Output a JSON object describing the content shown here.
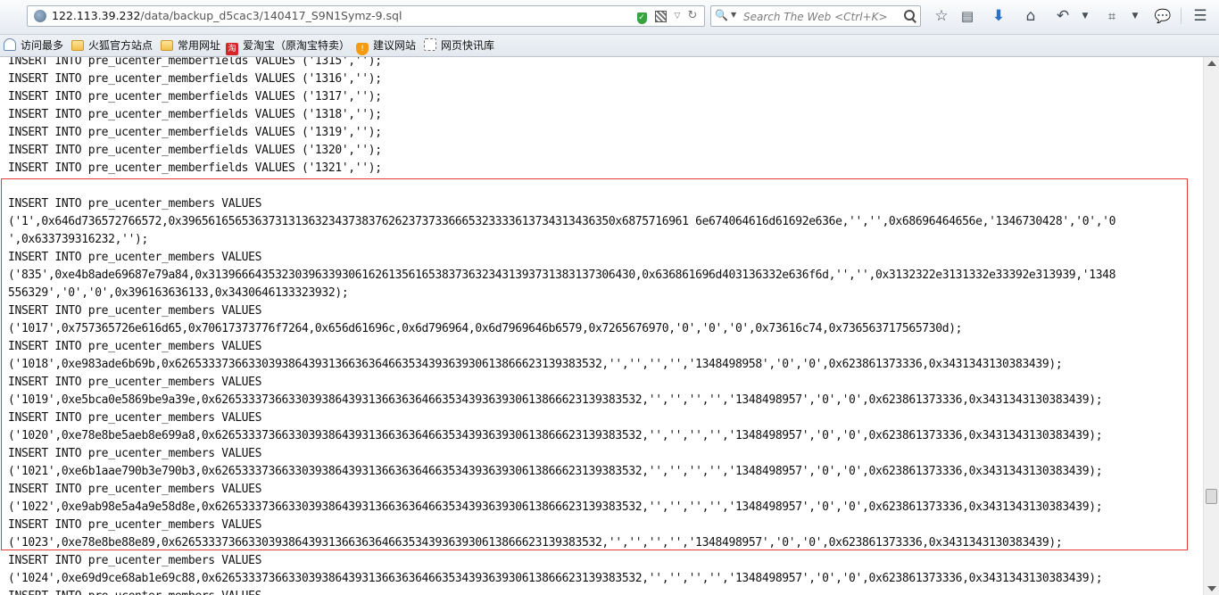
{
  "browser": {
    "url_host": "122.113.39.232",
    "url_path": "/data/backup_d5cac3/140417_S9N1Symz-9.sql",
    "search_placeholder": "Search The Web <Ctrl+K>",
    "icons": {
      "site": "globe-icon",
      "shield": "shield-icon",
      "qr": "qr-code-icon",
      "bookmark": "star-icon",
      "library": "reading-list-icon",
      "download": "download-arrow-icon",
      "home": "home-icon",
      "back": "undo-arrow-icon",
      "screenshot": "crop-icon",
      "chat": "chat-bubble-icon",
      "menu": "hamburger-menu-icon"
    }
  },
  "bookmarks": [
    {
      "label": "访问最多",
      "icon": "clip-icon"
    },
    {
      "label": "火狐官方站点",
      "icon": "folder-icon"
    },
    {
      "label": "常用网址",
      "icon": "folder-icon"
    },
    {
      "label": "爱淘宝（原淘宝特卖）",
      "icon": "taobao-icon"
    },
    {
      "label": "建议网站",
      "icon": "suggest-icon"
    },
    {
      "label": "网页快讯库",
      "icon": "web-slice-icon"
    }
  ],
  "highlight_color": "#e23b3b",
  "sql_lines": [
    "INSERT INTO pre_ucenter_memberfields VALUES ('1315','');",
    "INSERT INTO pre_ucenter_memberfields VALUES ('1316','');",
    "INSERT INTO pre_ucenter_memberfields VALUES ('1317','');",
    "INSERT INTO pre_ucenter_memberfields VALUES ('1318','');",
    "INSERT INTO pre_ucenter_memberfields VALUES ('1319','');",
    "INSERT INTO pre_ucenter_memberfields VALUES ('1320','');",
    "INSERT INTO pre_ucenter_memberfields VALUES ('1321','');",
    "",
    "INSERT INTO pre_ucenter_members VALUES",
    "('1',0x646d736572766572,0x39656165653637313136323437383762623737336665323333613734313436350x6875716961 6e674064616d61692e636e,'','',0x68696464656e,'1346730428','0','0",
    "',0x633739316232,'');",
    "INSERT INTO pre_ucenter_members VALUES",
    "('835',0xe4b8ade69687e79a84,0x3139666435323039633930616261356165383736323431393731383137306430,0x636861696d403136332e636f6d,'','',0x3132322e3131332e33392e313939,'1348",
    "556329','0','0',0x396163636133,0x3430646133323932);",
    "INSERT INTO pre_ucenter_members VALUES",
    "('1017',0x757365726e616d65,0x70617373776f7264,0x656d61696c,0x6d796964,0x6d7969646b6579,0x7265676970,'0','0','0',0x73616c74,0x736563717565730d);",
    "INSERT INTO pre_ucenter_members VALUES",
    "('1018',0xe983ade6b69b,0x6265333736633039386439313663636466353439363930613866623139383532,'','','','','1348498958','0','0',0x623861373336,0x3431343130383439);",
    "INSERT INTO pre_ucenter_members VALUES",
    "('1019',0xe5bca0e5869be9a39e,0x6265333736633039386439313663636466353439363930613866623139383532,'','','','','1348498957','0','0',0x623861373336,0x3431343130383439);",
    "INSERT INTO pre_ucenter_members VALUES",
    "('1020',0xe78e8be5aeb8e699a8,0x6265333736633039386439313663636466353439363930613866623139383532,'','','','','1348498957','0','0',0x623861373336,0x3431343130383439);",
    "INSERT INTO pre_ucenter_members VALUES",
    "('1021',0xe6b1aae790b3e790b3,0x6265333736633039386439313663636466353439363930613866623139383532,'','','','','1348498957','0','0',0x623861373336,0x3431343130383439);",
    "INSERT INTO pre_ucenter_members VALUES",
    "('1022',0xe9ab98e5a4a9e58d8e,0x6265333736633039386439313663636466353439363930613866623139383532,'','','','','1348498957','0','0',0x623861373336,0x3431343130383439);",
    "INSERT INTO pre_ucenter_members VALUES",
    "('1023',0xe78e8be88e89,0x6265333736633039386439313663636466353439363930613866623139383532,'','','','','1348498957','0','0',0x623861373336,0x3431343130383439);",
    "INSERT INTO pre_ucenter_members VALUES",
    "('1024',0xe69d9ce68ab1e69c88,0x6265333736633039386439313663636466353439363930613866623139383532,'','','','','1348498957','0','0',0x623861373336,0x3431343130383439);",
    "INSERT INTO pre_ucenter_members VALUES"
  ]
}
